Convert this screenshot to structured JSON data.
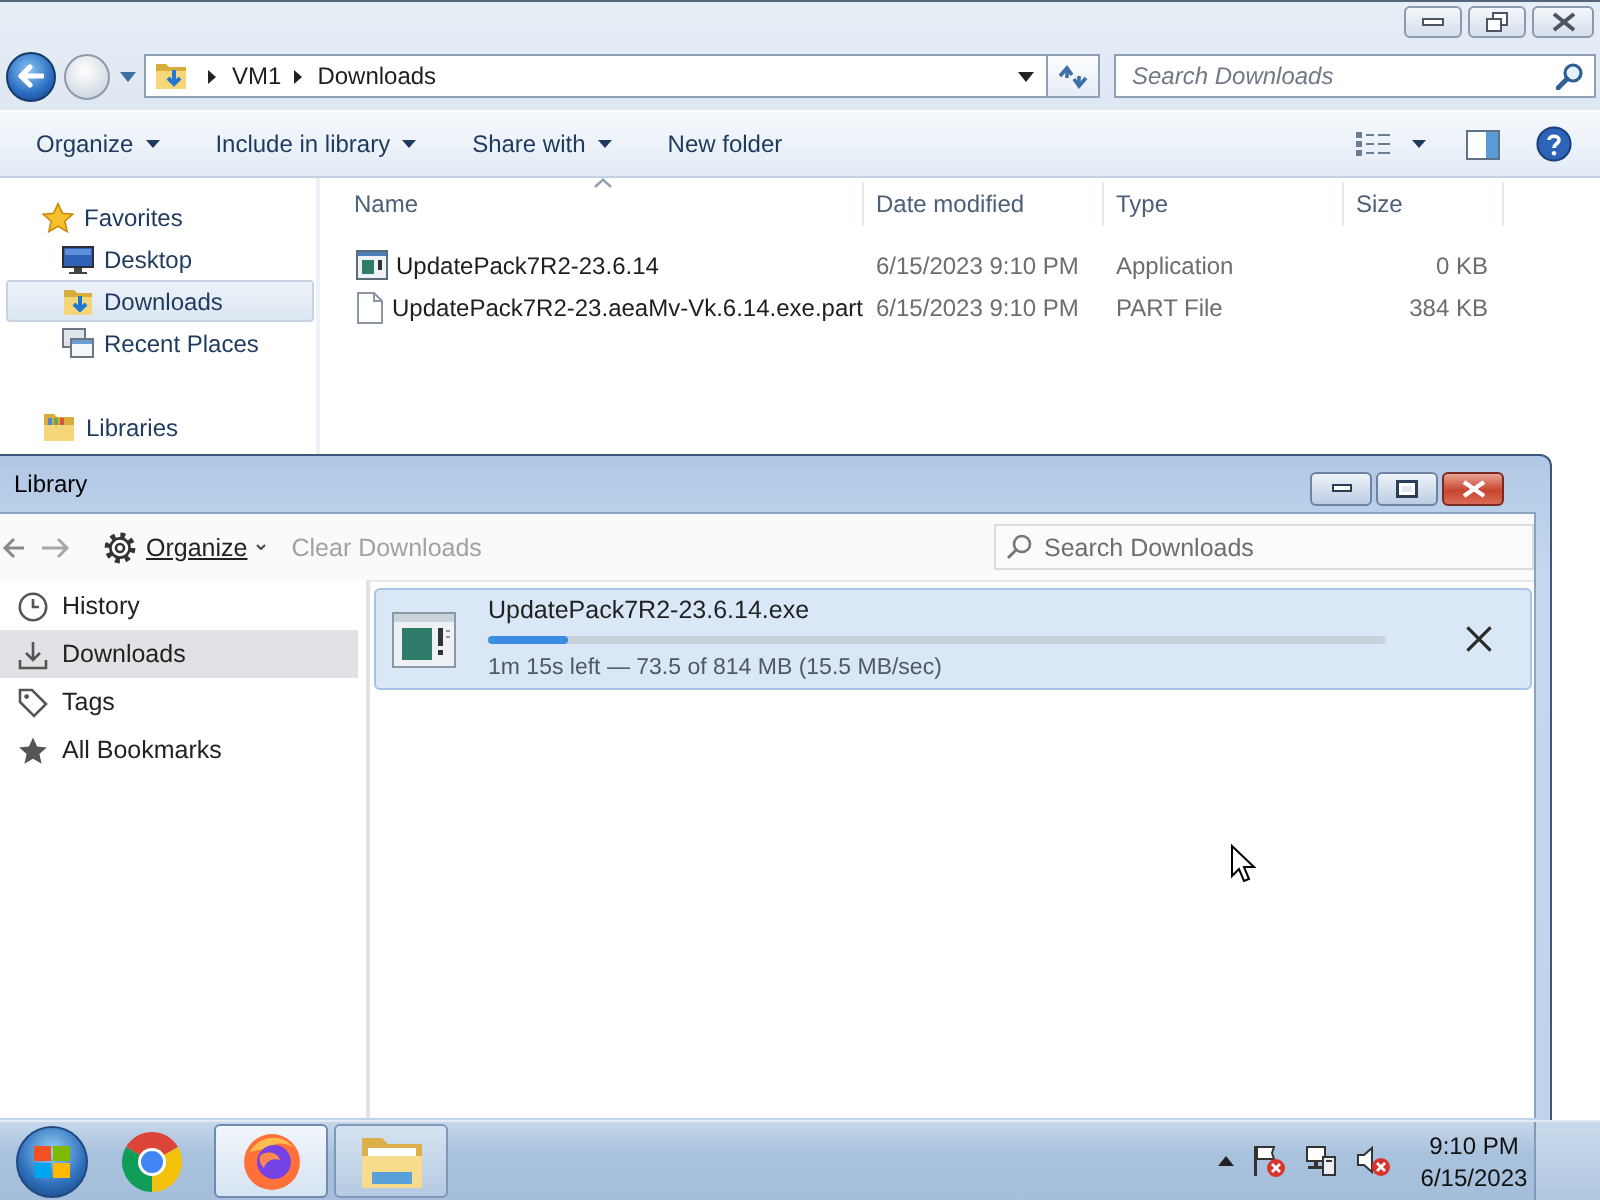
{
  "explorer": {
    "address": {
      "path": [
        "VM1",
        "Downloads"
      ]
    },
    "search": {
      "placeholder": "Search Downloads"
    },
    "commands": [
      {
        "label": "Organize",
        "dropdown": true
      },
      {
        "label": "Include in library",
        "dropdown": true
      },
      {
        "label": "Share with",
        "dropdown": true
      },
      {
        "label": "New folder",
        "dropdown": false
      }
    ],
    "nav": [
      {
        "label": "Favorites",
        "selected": false,
        "children": [
          {
            "label": "Desktop",
            "selected": false
          },
          {
            "label": "Downloads",
            "selected": true
          },
          {
            "label": "Recent Places",
            "selected": false
          }
        ]
      },
      {
        "label": "Libraries",
        "selected": false
      }
    ],
    "columns": [
      {
        "label": "Name",
        "sorted": true
      },
      {
        "label": "Date modified",
        "sorted": false
      },
      {
        "label": "Type",
        "sorted": false
      },
      {
        "label": "Size",
        "sorted": false
      }
    ],
    "files": [
      {
        "name": "UpdatePack7R2-23.6.14",
        "date": "6/15/2023 9:10 PM",
        "type": "Application",
        "size": "0 KB"
      },
      {
        "name": "UpdatePack7R2-23.aeaMv-Vk.6.14.exe.part",
        "date": "6/15/2023 9:10 PM",
        "type": "PART File",
        "size": "384 KB"
      }
    ]
  },
  "library": {
    "title": "Library",
    "organize": "Organize",
    "clear": {
      "label": "Clear Downloads",
      "disabled": true
    },
    "search": {
      "placeholder": "Search Downloads"
    },
    "sidebar": [
      {
        "label": "History",
        "selected": false
      },
      {
        "label": "Downloads",
        "selected": true
      },
      {
        "label": "Tags",
        "selected": false
      },
      {
        "label": "All Bookmarks",
        "selected": false
      }
    ],
    "downloads": [
      {
        "file": "UpdatePack7R2-23.6.14.exe",
        "level": 0.09,
        "status": "1m 15s left — 73.5 of 814 MB (15.5 MB/sec)",
        "selected": true
      }
    ]
  },
  "taskbar": {
    "apps": [
      {
        "running": false,
        "selected": false
      },
      {
        "running": true,
        "selected": true
      },
      {
        "running": true,
        "selected": false
      }
    ],
    "clock": {
      "time": "9:10 PM",
      "date": "6/15/2023"
    }
  }
}
